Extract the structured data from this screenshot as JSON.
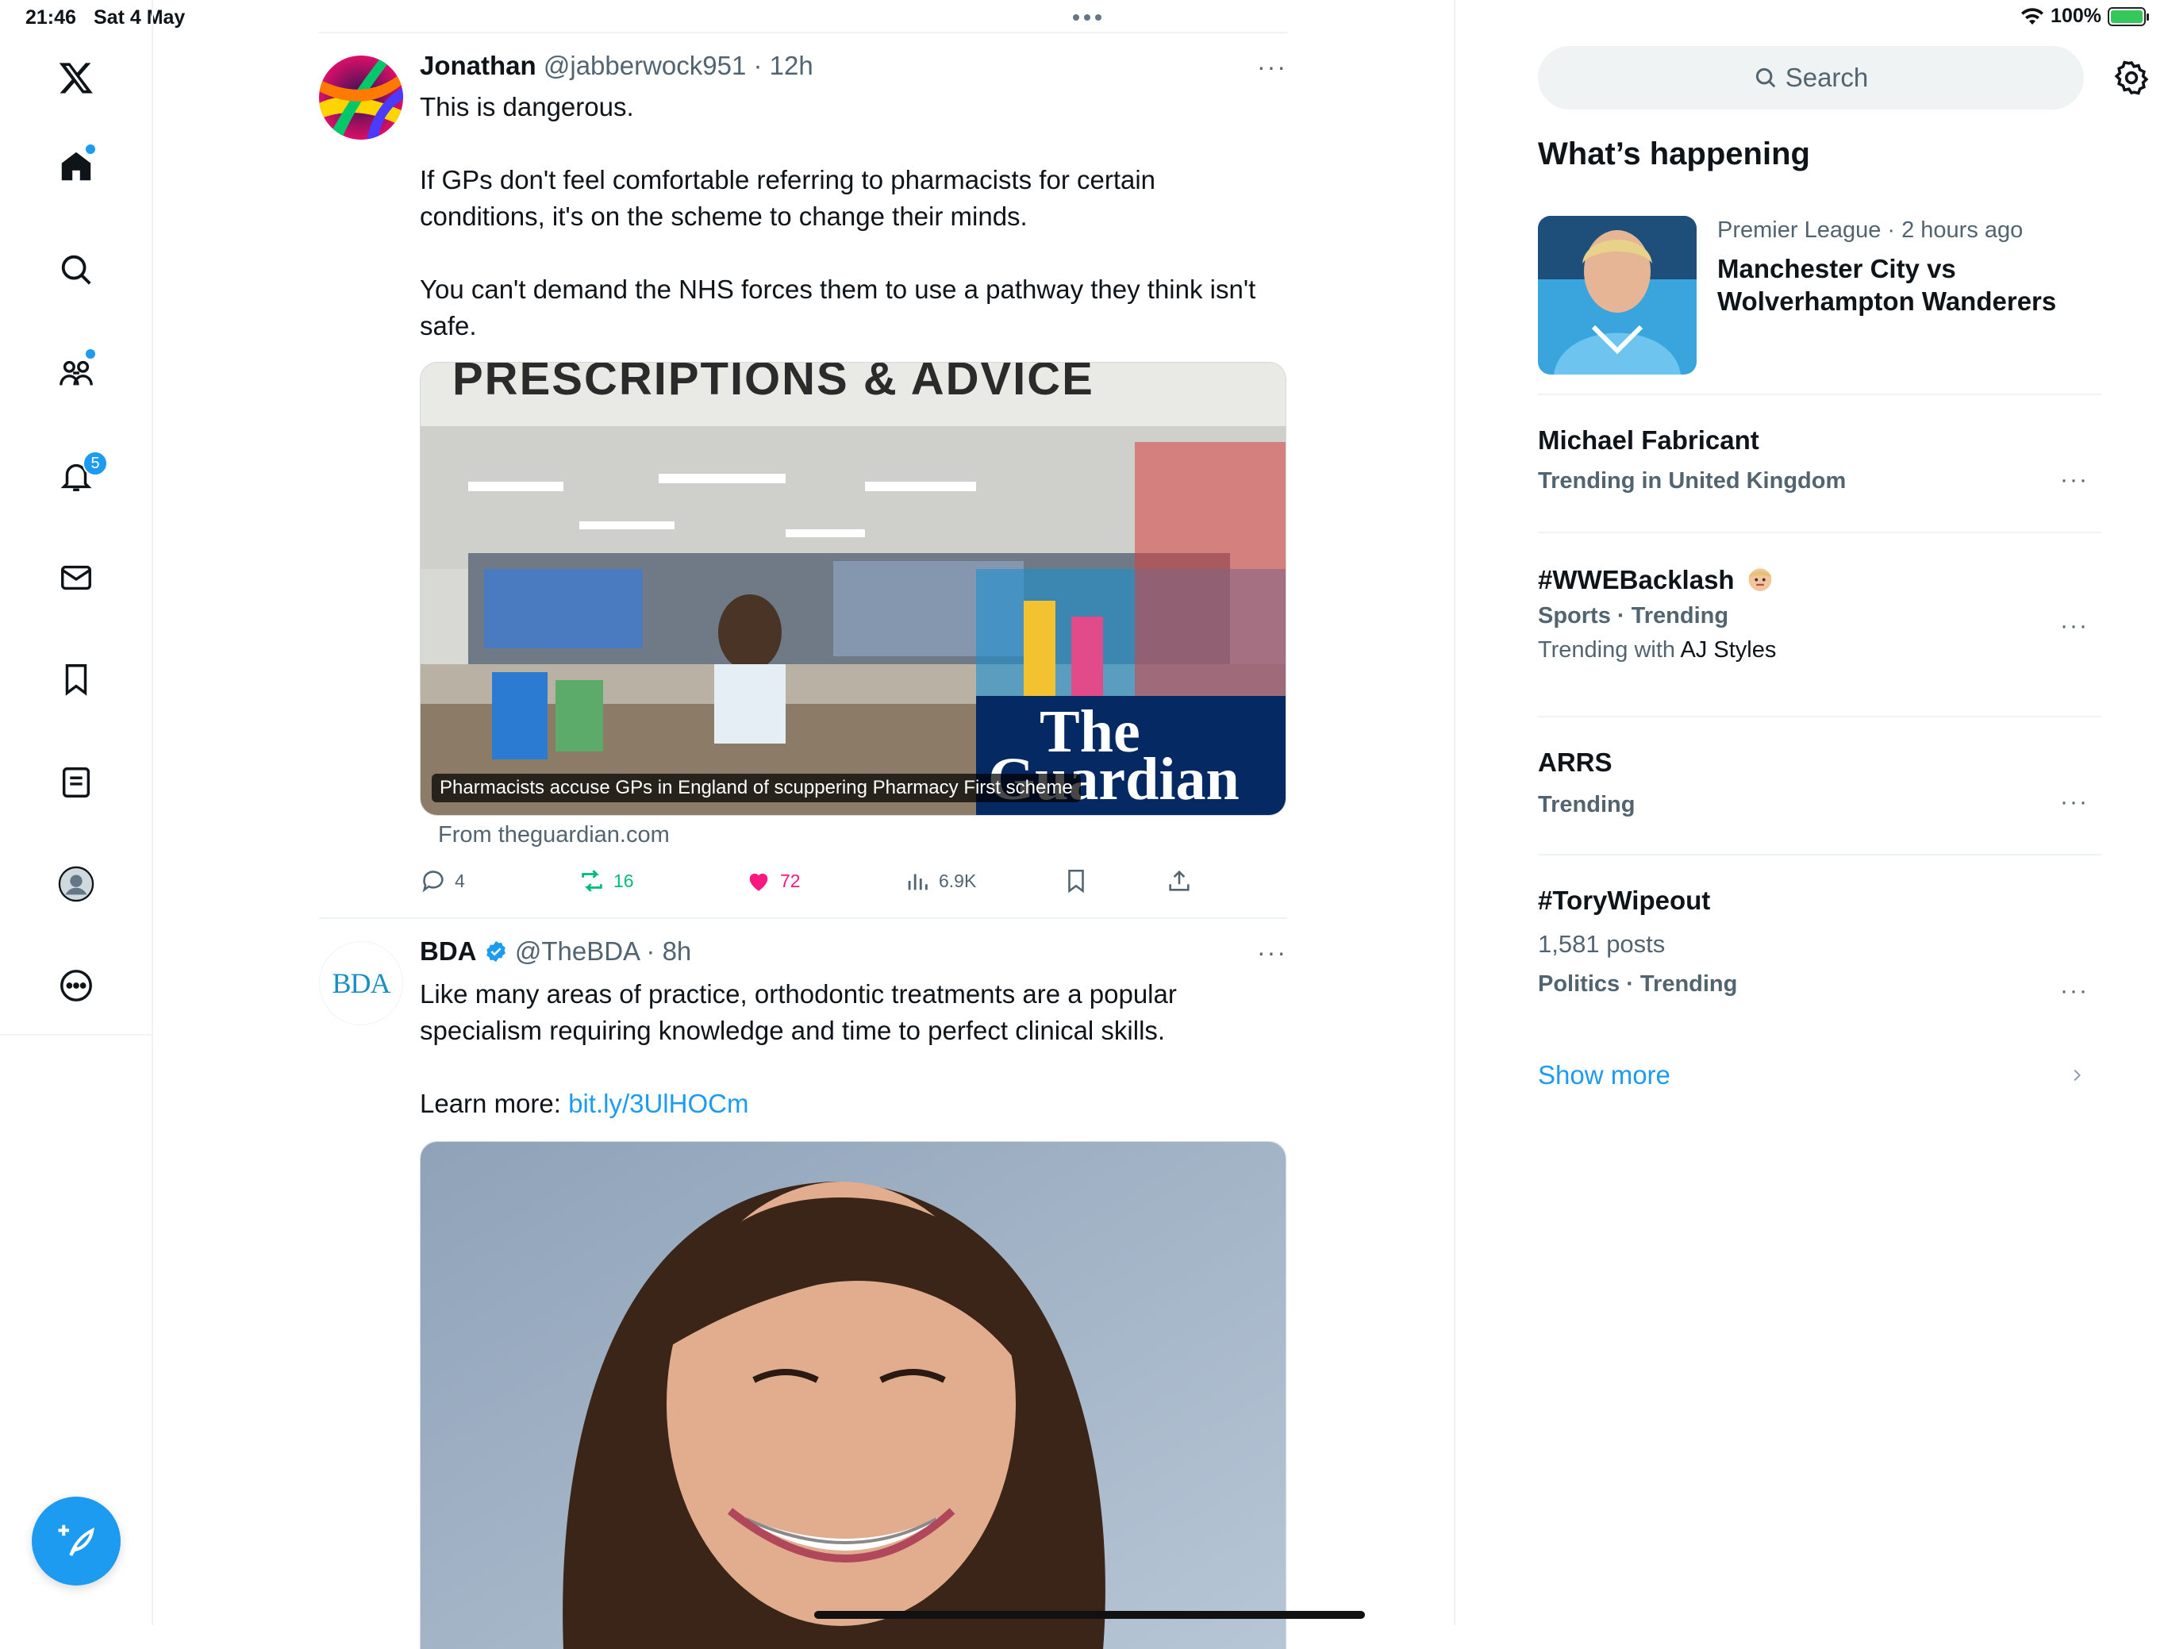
{
  "status_bar": {
    "time": "21:46",
    "date": "Sat 4 May",
    "battery": "100%"
  },
  "sidebar": {
    "notifications_count": "5"
  },
  "feed": {
    "tweets": [
      {
        "name": "Jonathan",
        "handle": "@jabberwock951",
        "time": "· 12h",
        "paragraphs": [
          "This is dangerous.",
          "If GPs don't feel comfortable referring to pharmacists for certain conditions, it's on the scheme to change their minds.",
          "You can't demand the NHS forces them to use a pathway they think isn't safe."
        ],
        "card": {
          "sign_text": "PRESCRIPTIONS & ADVICE",
          "logo_line1": "The",
          "logo_line2": "Guardian",
          "caption": "Pharmacists accuse GPs in England of scuppering Pharmacy First scheme",
          "from": "From theguardian.com"
        },
        "actions": {
          "replies": "4",
          "retweets": "16",
          "likes": "72",
          "views": "6.9K"
        }
      },
      {
        "name": "BDA",
        "handle": "@TheBDA",
        "time": "· 8h",
        "avatar_text": "BDA",
        "paragraphs": [
          "Like many areas of practice, orthodontic treatments are a popular specialism requiring knowledge and time to perfect clinical skills."
        ],
        "learn_more_label": "Learn more: ",
        "learn_more_link": "bit.ly/3UlHOCm"
      }
    ]
  },
  "right": {
    "search_placeholder": "Search",
    "whats_happening": "What’s happening",
    "featured": {
      "context": "Premier League · 2 hours ago",
      "title": "Manchester City vs Wolverhampton Wanderers"
    },
    "trends": [
      {
        "title": "Michael Fabricant",
        "context": "Trending in United Kingdom"
      },
      {
        "title": "#WWEBacklash",
        "context": "Sports · Trending",
        "extra_prefix": "Trending with ",
        "extra_name": "AJ Styles"
      },
      {
        "title": "ARRS",
        "context": "Trending"
      },
      {
        "title": "#ToryWipeout",
        "posts": "1,581 posts",
        "context": "Politics · Trending"
      }
    ],
    "show_more": "Show more"
  },
  "colors": {
    "accent": "#1d9bf0",
    "like": "#f91880",
    "retweet": "#00ba7c",
    "muted": "#536471"
  }
}
